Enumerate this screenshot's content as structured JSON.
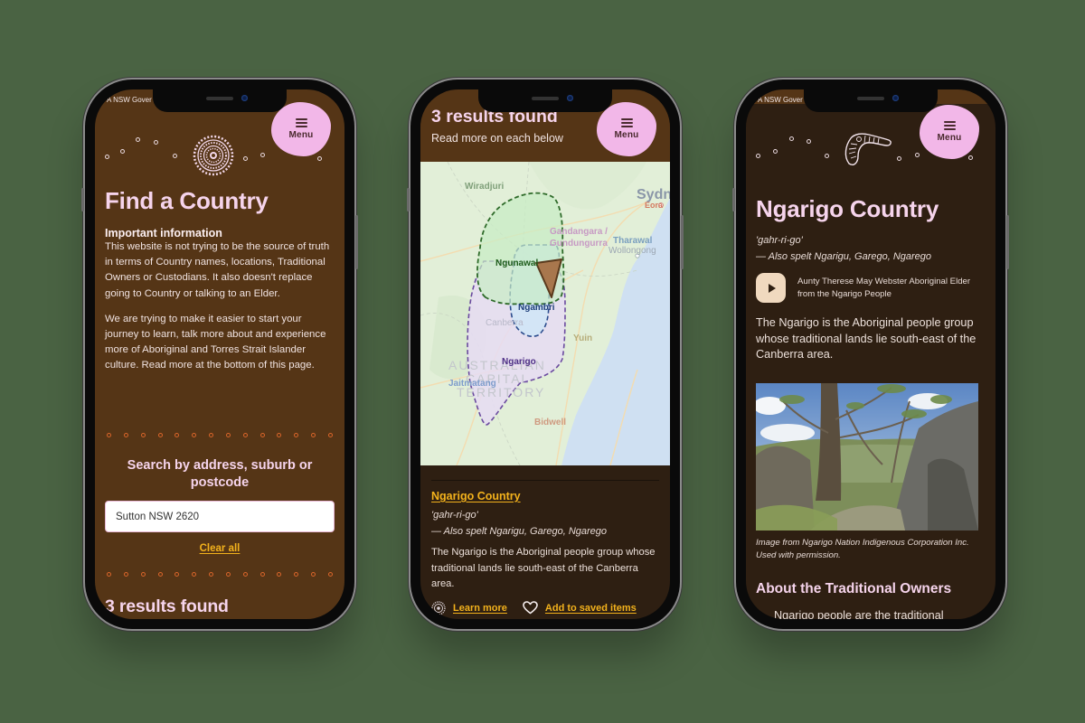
{
  "colors": {
    "background": "#4a6343",
    "header_brown": "#553516",
    "dark_brown": "#2e1f12",
    "pink_accent": "#f6d4ec",
    "menu_pink": "#f2b7e8",
    "link_yellow": "#f3b21c",
    "dot_orange": "#d9652a"
  },
  "common": {
    "gov_banner": "A NSW Gover",
    "menu_label": "Menu",
    "menu_icon": "hamburger-icon"
  },
  "phone1": {
    "emblem_icon": "concentric-dot-circle-icon",
    "title": "Find a Country",
    "important_heading": "Important information",
    "important_text": "This website is not trying to be the source of truth in terms of Country names, locations, Traditional Owners or Custodians. It also doesn't replace going to Country or talking to an Elder.",
    "intro_text": "We are trying to make it easier to start your journey to learn, talk more about and experience more of Aboriginal and Torres Strait Islander culture. Read more at the bottom of this page.",
    "search_heading": "Search by address, suburb or postcode",
    "search_value": "Sutton NSW 2620",
    "clear_all": "Clear all",
    "results_heading": "3 results found"
  },
  "phone2": {
    "results_title": "3 results found",
    "results_subtitle": "Read more on each below",
    "map": {
      "labels": {
        "wiradjuri": "Wiradjuri",
        "sydney": "Sydn",
        "eora": "Eora",
        "gandangara": "Gandangara /",
        "gundungurra": "Gundungurra",
        "tharawal": "Tharawal",
        "wollongong": "Wollongong",
        "ngunawal": "Ngunawal",
        "ngambri": "Ngambri",
        "canberra": "Canberra",
        "yuin": "Yuin",
        "ngarigo": "Ngarigo",
        "act_line1": "AUSTRALIAN",
        "act_line2": "CAPITAL",
        "act_line3": "TERRITORY",
        "jaitmatang": "Jaitmatang",
        "bidwell": "Bidwell"
      },
      "regions": [
        {
          "name": "Ngunawal",
          "color": "#2f6b2a"
        },
        {
          "name": "Ngambri",
          "color": "#1f3f7a"
        },
        {
          "name": "Ngarigo",
          "color": "#5b3a8f"
        }
      ],
      "marker_icon": "location-arrow-icon"
    },
    "card": {
      "title": "Ngarigo Country",
      "pronunciation": "'gahr-ri-go'",
      "also_spelt": "— Also spelt Ngarigu, Garego, Ngarego",
      "description": "The Ngarigo is the Aboriginal people group whose traditional lands lie south-east of the Canberra area.",
      "learn_more": "Learn more",
      "save": "Add to saved items"
    }
  },
  "phone3": {
    "emblem_icon": "boomerang-icon",
    "title": "Ngarigo Country",
    "pronunciation": "'gahr-ri-go'",
    "also_spelt": "— Also spelt Ngarigu, Garego, Ngarego",
    "audio_caption": "Aunty Therese May Webster Aboriginal Elder from the Ngarigo People",
    "description": "The Ngarigo is the Aboriginal people group whose traditional lands lie south-east of the Canberra area.",
    "image_alt": "Snow gum tree on rocky mountain landscape",
    "image_caption": "Image from Ngarigo Nation Indigenous Corporation Inc. Used with permission.",
    "section_heading": "About the Traditional Owners",
    "section_partial": "Ngarigo people are the traditional"
  }
}
